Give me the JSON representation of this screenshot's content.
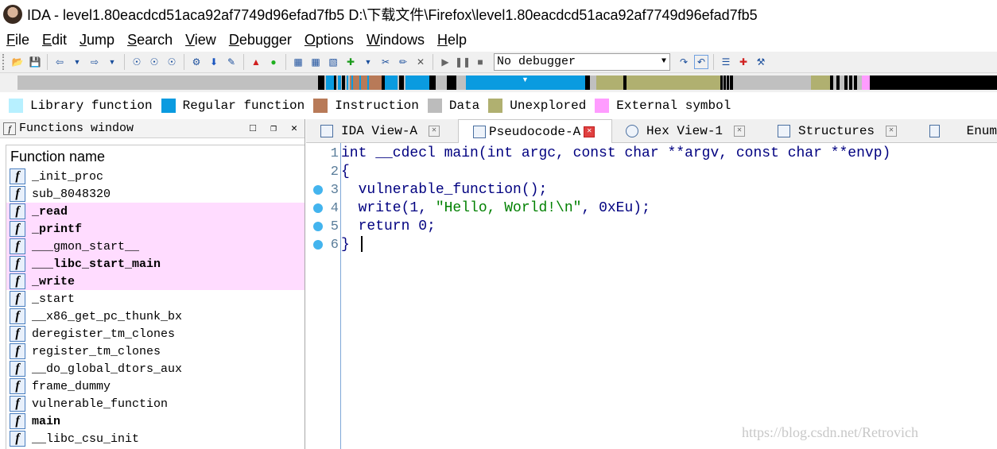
{
  "window": {
    "title": "IDA - level1.80eacdcd51aca92af7749d96efad7fb5 D:\\下载文件\\Firefox\\level1.80eacdcd51aca92af7749d96efad7fb5"
  },
  "menu": [
    {
      "u": "F",
      "rest": "ile"
    },
    {
      "u": "E",
      "rest": "dit"
    },
    {
      "u": "J",
      "rest": "ump"
    },
    {
      "u": "S",
      "rest": "earch"
    },
    {
      "u": "V",
      "rest": "iew"
    },
    {
      "u": "D",
      "rest": "ebugger"
    },
    {
      "u": "O",
      "rest": "ptions"
    },
    {
      "u": "W",
      "rest": "indows"
    },
    {
      "u": "H",
      "rest": "elp"
    }
  ],
  "toolbar": {
    "debugger_selected": "No debugger"
  },
  "legend": [
    {
      "label": "Library function",
      "color": "#b7f0ff"
    },
    {
      "label": "Regular function",
      "color": "#0a9be0"
    },
    {
      "label": "Instruction",
      "color": "#b87a58"
    },
    {
      "label": "Data",
      "color": "#bcbcbc"
    },
    {
      "label": "Unexplored",
      "color": "#b0b070"
    },
    {
      "label": "External symbol",
      "color": "#ff9cff"
    }
  ],
  "functions_window": {
    "title": "Functions window",
    "column": "Function name",
    "items": [
      {
        "name": "_init_proc",
        "style": ""
      },
      {
        "name": "sub_8048320",
        "style": ""
      },
      {
        "name": "_read",
        "style": "imp"
      },
      {
        "name": "_printf",
        "style": "imp"
      },
      {
        "name": "___gmon_start__",
        "style": "ext"
      },
      {
        "name": "___libc_start_main",
        "style": "imp"
      },
      {
        "name": "_write",
        "style": "imp"
      },
      {
        "name": "_start",
        "style": ""
      },
      {
        "name": "__x86_get_pc_thunk_bx",
        "style": ""
      },
      {
        "name": "deregister_tm_clones",
        "style": ""
      },
      {
        "name": "register_tm_clones",
        "style": ""
      },
      {
        "name": "__do_global_dtors_aux",
        "style": ""
      },
      {
        "name": "frame_dummy",
        "style": ""
      },
      {
        "name": "vulnerable_function",
        "style": ""
      },
      {
        "name": "main",
        "style": "bold"
      },
      {
        "name": "__libc_csu_init",
        "style": ""
      }
    ]
  },
  "tabs": [
    {
      "label": "IDA View-A",
      "active": false
    },
    {
      "label": "Pseudocode-A",
      "active": true
    },
    {
      "label": "Hex View-1",
      "active": false
    },
    {
      "label": "Structures",
      "active": false
    },
    {
      "label": "Enum",
      "active": false
    }
  ],
  "pseudocode": {
    "lines": [
      {
        "n": "1",
        "dot": false,
        "code": "int __cdecl main(int argc, const char **argv, const char **envp)"
      },
      {
        "n": "2",
        "dot": false,
        "code": "{"
      },
      {
        "n": "3",
        "dot": true,
        "code": "  vulnerable_function();"
      },
      {
        "n": "4",
        "dot": true,
        "code_pre": "  write(1, ",
        "code_str": "\"Hello, World!\\n\"",
        "code_post": ", 0xEu);"
      },
      {
        "n": "5",
        "dot": true,
        "code": "  return 0;"
      },
      {
        "n": "6",
        "dot": true,
        "code": "}"
      }
    ]
  },
  "watermark": "https://blog.csdn.net/Retrovich"
}
